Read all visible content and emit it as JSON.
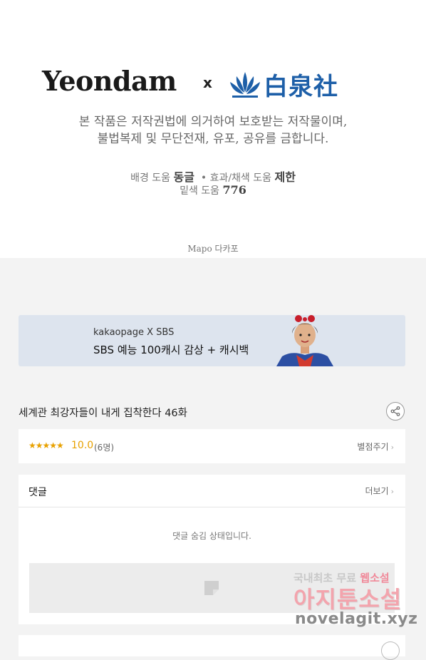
{
  "header": {
    "logo_left": "Yeondam",
    "logo_sep": "x",
    "logo_right": "白泉社",
    "notice_line1": "본 작품은 저작권법에 의거하여 보호받는 저작물이며,",
    "notice_line2": "불법복제 및 무단전재, 유포, 공유를 금합니다.",
    "credits": {
      "bg_label": "배경 도움",
      "bg_name": "동글",
      "bullet": "•",
      "fx_label": "효과/채색 도움",
      "fx_name": "제한",
      "base_label": "밑색 도움",
      "base_name": "776"
    },
    "mapo": "Mapo 다카포"
  },
  "banner": {
    "line1": "kakaopage X SBS",
    "line2": "SBS 예능 100캐시 감상 + 캐시백"
  },
  "episode": {
    "title": "세계관 최강자들이 내게 집착한다 46화"
  },
  "rating": {
    "stars": "★★★★★",
    "score": "10.0",
    "count": "(6명)",
    "rate_link": "별점주기"
  },
  "comments": {
    "heading": "댓글",
    "more_link": "더보기",
    "hidden_message": "댓글 숨김 상태입니다."
  },
  "watermark": {
    "line1_a": "국내최초 무료",
    "line1_b": "웹소설",
    "line2": "아지툰소설",
    "line3": "novelagit.xyz"
  },
  "colors": {
    "accent": "#e8a100",
    "brand_blue": "#1d5fa8",
    "banner_bg": "#dde4ee",
    "page_bg": "#f3f3f3"
  }
}
